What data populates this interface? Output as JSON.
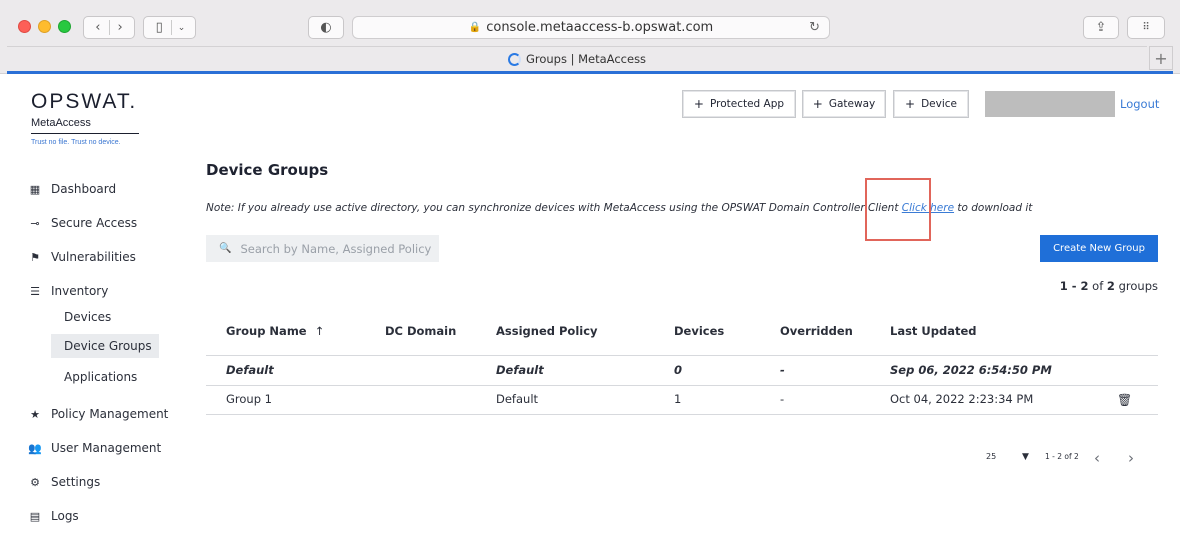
{
  "browser": {
    "url": "console.metaaccess-b.opswat.com",
    "tab_title": "Groups | MetaAccess"
  },
  "brand": {
    "logo": "OPSWAT.",
    "product": "MetaAccess",
    "tagline": "Trust no file. Trust no device."
  },
  "sidebar": {
    "items": [
      {
        "label": "Dashboard",
        "icon": "grid-icon"
      },
      {
        "label": "Secure Access",
        "icon": "key-icon"
      },
      {
        "label": "Vulnerabilities",
        "icon": "flag-icon"
      },
      {
        "label": "Inventory",
        "icon": "list-icon"
      },
      {
        "label": "Policy Management",
        "icon": "star-icon"
      },
      {
        "label": "User Management",
        "icon": "users-icon"
      },
      {
        "label": "Settings",
        "icon": "gear-icon"
      },
      {
        "label": "Logs",
        "icon": "clipboard-icon"
      }
    ],
    "inventory_sub": [
      "Devices",
      "Device Groups",
      "Applications"
    ]
  },
  "header": {
    "protected_app": "Protected App",
    "gateway": "Gateway",
    "device": "Device",
    "logout": "Logout"
  },
  "main": {
    "title": "Device Groups",
    "note_prefix": "Note: If you already use active directory, you can synchronize devices with MetaAccess using the OPSWAT Domain Controller Client",
    "note_link": "Click here",
    "note_suffix": "to download it",
    "search_placeholder": "Search by Name, Assigned Policy",
    "create_button": "Create New Group",
    "count_range": "1 - 2",
    "count_of": "of",
    "count_total": "2",
    "count_unit": "groups"
  },
  "table": {
    "headers": [
      "Group Name",
      "DC Domain",
      "Assigned Policy",
      "Devices",
      "Overridden",
      "Last Updated"
    ],
    "sort_indicator": "↑",
    "rows": [
      {
        "name": "Default",
        "dc_domain": "",
        "policy": "Default",
        "devices": "0",
        "overridden": "-",
        "updated": "Sep 06, 2022 6:54:50 PM"
      },
      {
        "name": "Group 1",
        "dc_domain": "",
        "policy": "Default",
        "devices": "1",
        "overridden": "-",
        "updated": "Oct 04, 2022 2:23:34 PM"
      }
    ]
  },
  "pagination": {
    "page_size": "25",
    "range": "1 - 2 of 2"
  }
}
